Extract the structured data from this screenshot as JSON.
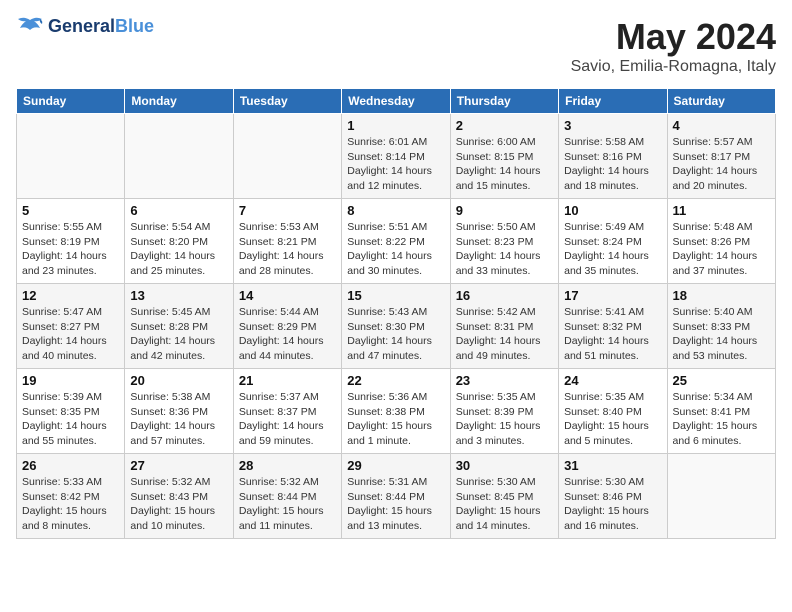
{
  "header": {
    "logo_line1": "General",
    "logo_line2": "Blue",
    "month_title": "May 2024",
    "subtitle": "Savio, Emilia-Romagna, Italy"
  },
  "weekdays": [
    "Sunday",
    "Monday",
    "Tuesday",
    "Wednesday",
    "Thursday",
    "Friday",
    "Saturday"
  ],
  "weeks": [
    [
      {
        "day": "",
        "info": ""
      },
      {
        "day": "",
        "info": ""
      },
      {
        "day": "",
        "info": ""
      },
      {
        "day": "1",
        "info": "Sunrise: 6:01 AM\nSunset: 8:14 PM\nDaylight: 14 hours\nand 12 minutes."
      },
      {
        "day": "2",
        "info": "Sunrise: 6:00 AM\nSunset: 8:15 PM\nDaylight: 14 hours\nand 15 minutes."
      },
      {
        "day": "3",
        "info": "Sunrise: 5:58 AM\nSunset: 8:16 PM\nDaylight: 14 hours\nand 18 minutes."
      },
      {
        "day": "4",
        "info": "Sunrise: 5:57 AM\nSunset: 8:17 PM\nDaylight: 14 hours\nand 20 minutes."
      }
    ],
    [
      {
        "day": "5",
        "info": "Sunrise: 5:55 AM\nSunset: 8:19 PM\nDaylight: 14 hours\nand 23 minutes."
      },
      {
        "day": "6",
        "info": "Sunrise: 5:54 AM\nSunset: 8:20 PM\nDaylight: 14 hours\nand 25 minutes."
      },
      {
        "day": "7",
        "info": "Sunrise: 5:53 AM\nSunset: 8:21 PM\nDaylight: 14 hours\nand 28 minutes."
      },
      {
        "day": "8",
        "info": "Sunrise: 5:51 AM\nSunset: 8:22 PM\nDaylight: 14 hours\nand 30 minutes."
      },
      {
        "day": "9",
        "info": "Sunrise: 5:50 AM\nSunset: 8:23 PM\nDaylight: 14 hours\nand 33 minutes."
      },
      {
        "day": "10",
        "info": "Sunrise: 5:49 AM\nSunset: 8:24 PM\nDaylight: 14 hours\nand 35 minutes."
      },
      {
        "day": "11",
        "info": "Sunrise: 5:48 AM\nSunset: 8:26 PM\nDaylight: 14 hours\nand 37 minutes."
      }
    ],
    [
      {
        "day": "12",
        "info": "Sunrise: 5:47 AM\nSunset: 8:27 PM\nDaylight: 14 hours\nand 40 minutes."
      },
      {
        "day": "13",
        "info": "Sunrise: 5:45 AM\nSunset: 8:28 PM\nDaylight: 14 hours\nand 42 minutes."
      },
      {
        "day": "14",
        "info": "Sunrise: 5:44 AM\nSunset: 8:29 PM\nDaylight: 14 hours\nand 44 minutes."
      },
      {
        "day": "15",
        "info": "Sunrise: 5:43 AM\nSunset: 8:30 PM\nDaylight: 14 hours\nand 47 minutes."
      },
      {
        "day": "16",
        "info": "Sunrise: 5:42 AM\nSunset: 8:31 PM\nDaylight: 14 hours\nand 49 minutes."
      },
      {
        "day": "17",
        "info": "Sunrise: 5:41 AM\nSunset: 8:32 PM\nDaylight: 14 hours\nand 51 minutes."
      },
      {
        "day": "18",
        "info": "Sunrise: 5:40 AM\nSunset: 8:33 PM\nDaylight: 14 hours\nand 53 minutes."
      }
    ],
    [
      {
        "day": "19",
        "info": "Sunrise: 5:39 AM\nSunset: 8:35 PM\nDaylight: 14 hours\nand 55 minutes."
      },
      {
        "day": "20",
        "info": "Sunrise: 5:38 AM\nSunset: 8:36 PM\nDaylight: 14 hours\nand 57 minutes."
      },
      {
        "day": "21",
        "info": "Sunrise: 5:37 AM\nSunset: 8:37 PM\nDaylight: 14 hours\nand 59 minutes."
      },
      {
        "day": "22",
        "info": "Sunrise: 5:36 AM\nSunset: 8:38 PM\nDaylight: 15 hours\nand 1 minute."
      },
      {
        "day": "23",
        "info": "Sunrise: 5:35 AM\nSunset: 8:39 PM\nDaylight: 15 hours\nand 3 minutes."
      },
      {
        "day": "24",
        "info": "Sunrise: 5:35 AM\nSunset: 8:40 PM\nDaylight: 15 hours\nand 5 minutes."
      },
      {
        "day": "25",
        "info": "Sunrise: 5:34 AM\nSunset: 8:41 PM\nDaylight: 15 hours\nand 6 minutes."
      }
    ],
    [
      {
        "day": "26",
        "info": "Sunrise: 5:33 AM\nSunset: 8:42 PM\nDaylight: 15 hours\nand 8 minutes."
      },
      {
        "day": "27",
        "info": "Sunrise: 5:32 AM\nSunset: 8:43 PM\nDaylight: 15 hours\nand 10 minutes."
      },
      {
        "day": "28",
        "info": "Sunrise: 5:32 AM\nSunset: 8:44 PM\nDaylight: 15 hours\nand 11 minutes."
      },
      {
        "day": "29",
        "info": "Sunrise: 5:31 AM\nSunset: 8:44 PM\nDaylight: 15 hours\nand 13 minutes."
      },
      {
        "day": "30",
        "info": "Sunrise: 5:30 AM\nSunset: 8:45 PM\nDaylight: 15 hours\nand 14 minutes."
      },
      {
        "day": "31",
        "info": "Sunrise: 5:30 AM\nSunset: 8:46 PM\nDaylight: 15 hours\nand 16 minutes."
      },
      {
        "day": "",
        "info": ""
      }
    ]
  ]
}
